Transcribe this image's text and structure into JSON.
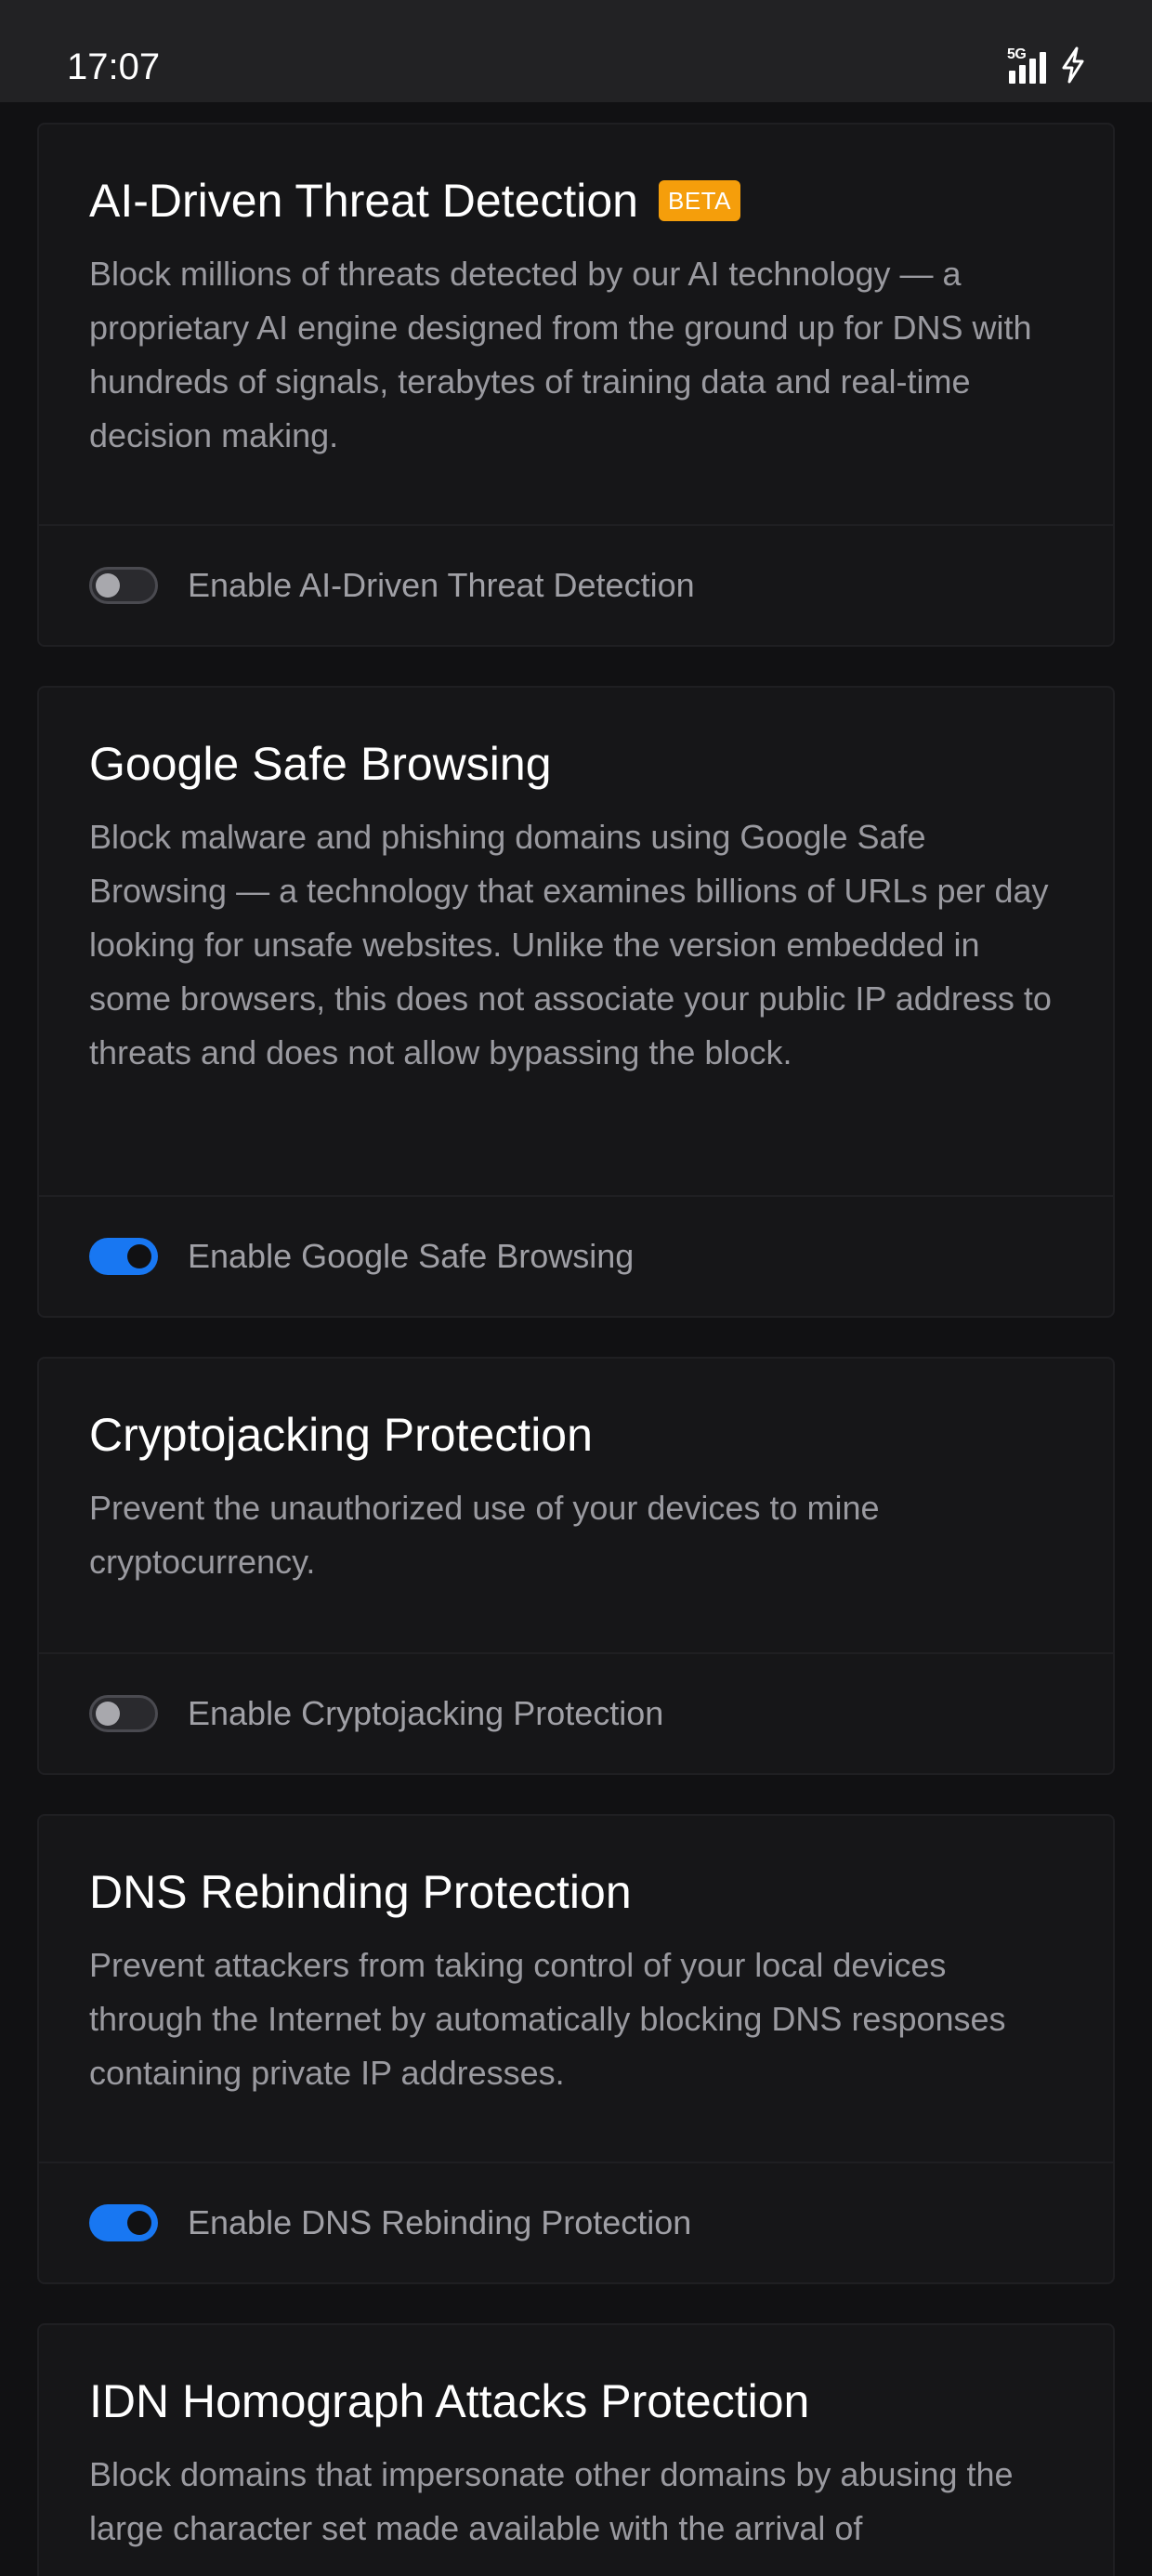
{
  "status_bar": {
    "time": "17:07",
    "network": "5G"
  },
  "cards": [
    {
      "title": "AI-Driven Threat Detection",
      "badge": "BETA",
      "description": "Block millions of threats detected by our AI technology — a proprietary AI engine designed from the ground up for DNS with hundreds of signals, terabytes of training data and real-time decision making.",
      "toggle_label": "Enable AI-Driven Threat Detection",
      "enabled": false
    },
    {
      "title": "Google Safe Browsing",
      "description": "Block malware and phishing domains using Google Safe Browsing — a technology that examines billions of URLs per day looking for unsafe websites. Unlike the version embedded in some browsers, this does not associate your public IP address to threats and does not allow bypassing the block.",
      "toggle_label": "Enable Google Safe Browsing",
      "enabled": true
    },
    {
      "title": "Cryptojacking Protection",
      "description": "Prevent the unauthorized use of your devices to mine cryptocurrency.",
      "toggle_label": "Enable Cryptojacking Protection",
      "enabled": false
    },
    {
      "title": "DNS Rebinding Protection",
      "description": "Prevent attackers from taking control of your local devices through the Internet by automatically blocking DNS responses containing private IP addresses.",
      "toggle_label": "Enable DNS Rebinding Protection",
      "enabled": true
    },
    {
      "title": "IDN Homograph Attacks Protection",
      "description": "Block domains that impersonate other domains by abusing the large character set made available with the arrival of"
    }
  ],
  "colors": {
    "toggle_on": "#1877f2",
    "badge": "#f59e0b",
    "background": "#111113"
  }
}
